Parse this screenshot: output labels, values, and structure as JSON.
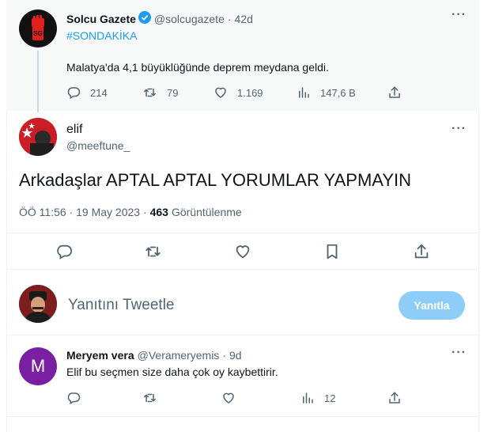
{
  "quoted_tweet": {
    "author_name": "Solcu Gazete",
    "handle": "@solcugazete",
    "separator": "·",
    "time": "42d",
    "hashtag": "#SONDAKİKA",
    "text": "Malatya'da 4,1 büyüklüğünde deprem meydana geldi.",
    "stats": {
      "replies": "214",
      "retweets": "79",
      "likes": "1.169",
      "views": "147,6 B"
    }
  },
  "main_tweet": {
    "author_name": "elif",
    "handle": "@meeftune_",
    "text": "Arkadaşlar APTAL APTAL YORUMLAR YAPMAYIN",
    "time": "ÖÖ 11:56 · 19 May 2023 ·",
    "views_count": "463",
    "views_label": "Görüntülenme"
  },
  "compose": {
    "placeholder": "Yanıtını Tweetle",
    "button_label": "Yanıtla"
  },
  "reply_tweet": {
    "avatar_letter": "M",
    "author_name": "Meryem vera",
    "handle": "@Verameryemis",
    "separator": "·",
    "time": "9d",
    "text": "Elif bu seçmen size daha çok oy kaybettirir.",
    "stats": {
      "views": "12"
    }
  },
  "colors": {
    "accent": "#1d9bf0",
    "verified": "#1d9bf0",
    "button_disabled": "#8ecdf8",
    "reply_avatar": "#7b1fa2",
    "solcu_red": "#e0201c"
  }
}
